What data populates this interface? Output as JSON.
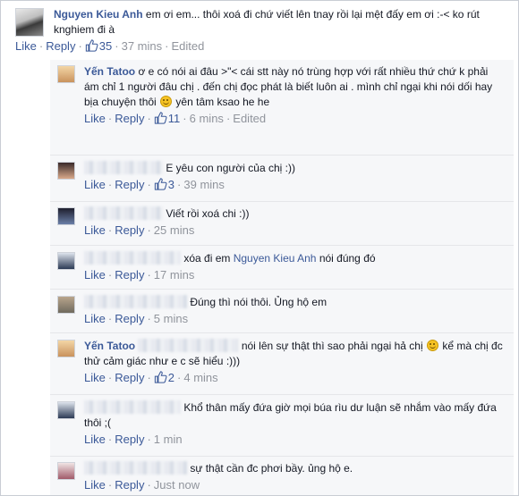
{
  "actions": {
    "like": "Like",
    "reply": "Reply",
    "dot": "·",
    "edited": "Edited"
  },
  "top_comment": {
    "author": "Nguyen Kieu Anh",
    "text": "em ơi em... thôi xoá đi chứ viết lên tnay rồi lại mệt đấy em ơi :-< ko rút knghiem đi à",
    "likes": "35",
    "time": "37 mins"
  },
  "replies": [
    {
      "author": "Yến Tatoo",
      "text_a": "ơ e có nói ai đâu >\"< cái stt này nó trùng hợp với rất nhiều thứ chứ k phải ám chỉ 1 người đâu chị . đến chị đọc phát là biết luôn ai . mình chỉ ngại khi nói dối hay bịa chuyện thôi",
      "text_b": "yên tâm ksao he he",
      "likes": "11",
      "time": "6 mins"
    },
    {
      "text": "E yêu con người của chị :))",
      "likes": "3",
      "time": "39 mins"
    },
    {
      "text": "Viết rồi xoá chi :))",
      "time": "25 mins"
    },
    {
      "text_a": "xóa đi em",
      "mention": "Nguyen Kieu Anh",
      "text_b": "nói đúng đó",
      "time": "17 mins"
    },
    {
      "text": "Đúng thì nói thôi. Ủng hộ em",
      "time": "5 mins"
    },
    {
      "author": "Yến Tatoo",
      "text_a": "nói lên sự thật thì sao phải ngại hả chị",
      "text_b": "kể mà chị đc thử cảm giác như e c sẽ hiểu :)))",
      "likes": "2",
      "time": "4 mins"
    },
    {
      "text": "Khổ thân mấy đứa giờ mọi búa rìu dư luận sẽ nhắm vào mấy đứa thôi ;(",
      "time": "1 min"
    },
    {
      "text": "sự thật cần đc phơi bầy. ủng hộ e.",
      "time": "Just now"
    }
  ],
  "colors": {
    "link": "#3b5998",
    "meta": "#90949c",
    "reply_bg": "#f6f7f9"
  }
}
